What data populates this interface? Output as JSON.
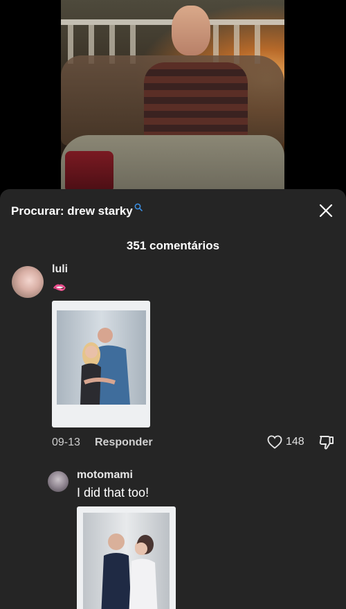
{
  "search": {
    "label": "Procurar: drew starky"
  },
  "comments_header": {
    "count_label": "351 comentários"
  },
  "comments": [
    {
      "username": "luli",
      "text": "🫦",
      "date": "09-13",
      "reply_label": "Responder",
      "likes": "148"
    },
    {
      "username": "motomami",
      "text": "I did that too!"
    }
  ],
  "colors": {
    "sheet_bg": "#252525",
    "background": "#000000",
    "search_accent": "#3b8ee0"
  },
  "icons": {
    "search": "search-icon",
    "close": "close-icon",
    "like": "heart-icon",
    "dislike": "thumbs-down-icon"
  }
}
